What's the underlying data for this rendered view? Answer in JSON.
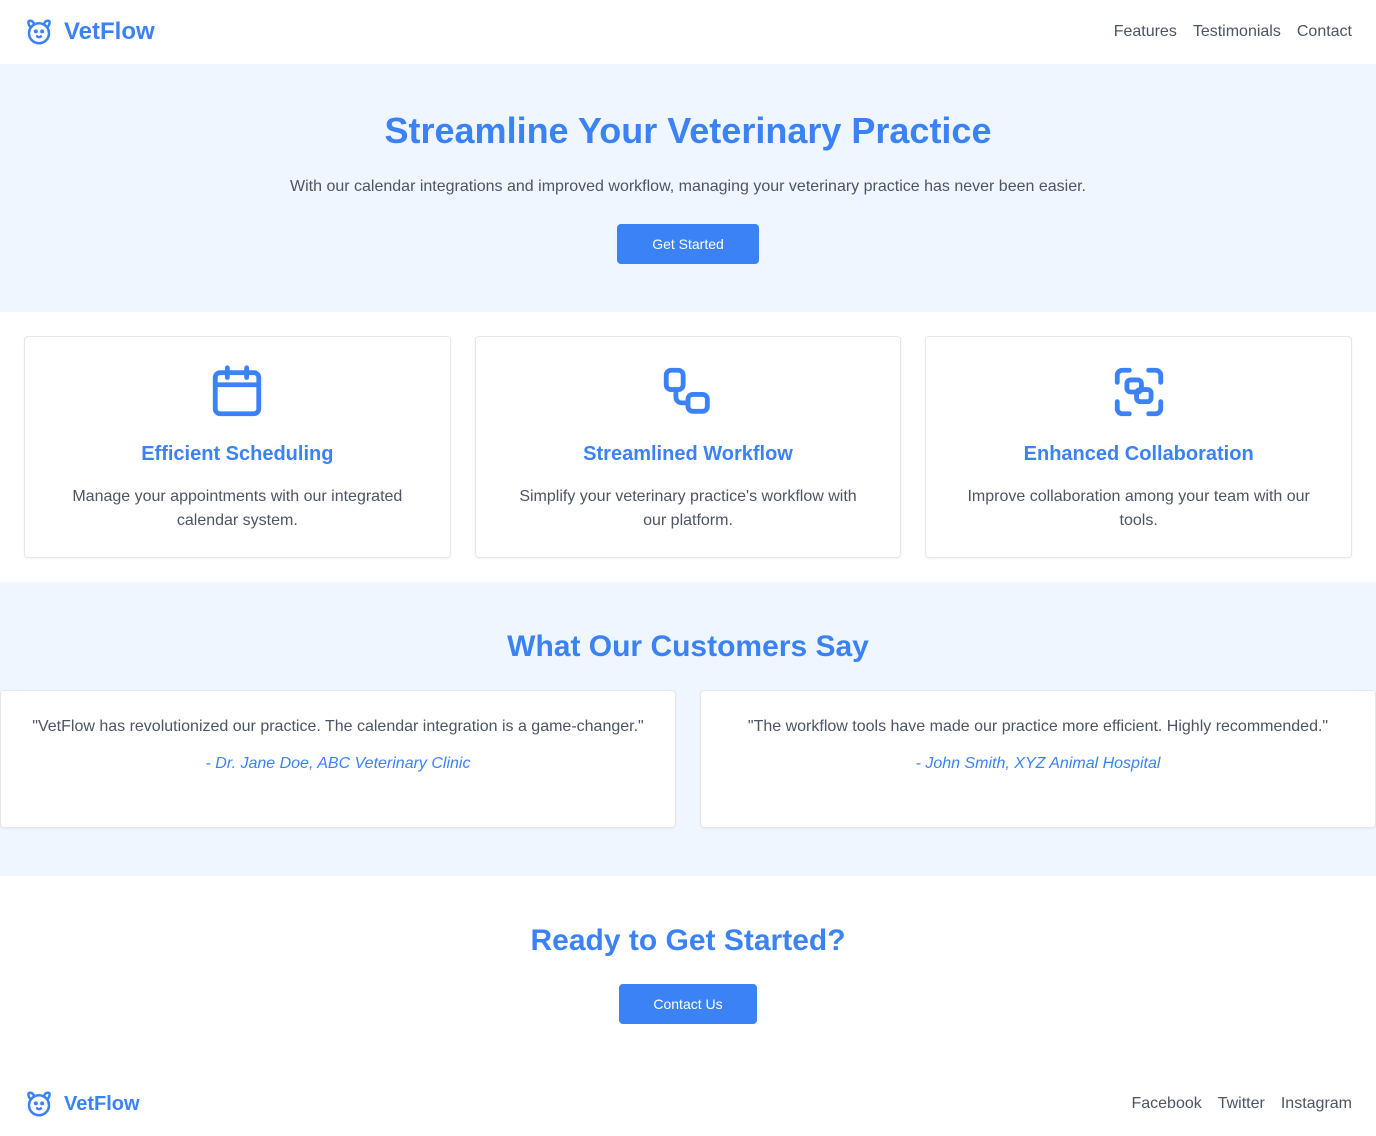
{
  "header": {
    "brand": "VetFlow",
    "brand_icon": "dog-icon",
    "nav": [
      "Features",
      "Testimonials",
      "Contact"
    ]
  },
  "hero": {
    "title": "Streamline Your Veterinary Practice",
    "subtitle": "With our calendar integrations and improved workflow, managing your veterinary practice has never been easier.",
    "cta_label": "Get Started"
  },
  "features": [
    {
      "icon": "calendar-icon",
      "title": "Efficient Scheduling",
      "description": "Manage your appointments with our integrated calendar system."
    },
    {
      "icon": "workflow-icon",
      "title": "Streamlined Workflow",
      "description": "Simplify your veterinary practice's workflow with our platform."
    },
    {
      "icon": "collaboration-icon",
      "title": "Enhanced Collaboration",
      "description": "Improve collaboration among your team with our tools."
    }
  ],
  "testimonials": {
    "title": "What Our Customers Say",
    "items": [
      {
        "quote": "\"VetFlow has revolutionized our practice. The calendar integration is a game-changer.\"",
        "author": "- Dr. Jane Doe, ABC Veterinary Clinic"
      },
      {
        "quote": "\"The workflow tools have made our practice more efficient. Highly recommended.\"",
        "author": "- John Smith, XYZ Animal Hospital"
      }
    ]
  },
  "cta": {
    "title": "Ready to Get Started?",
    "button_label": "Contact Us"
  },
  "footer": {
    "brand": "VetFlow",
    "links": [
      "Facebook",
      "Twitter",
      "Instagram"
    ]
  },
  "colors": {
    "accent": "#3b82f6",
    "section_bg": "#eff6ff",
    "text": "#4b5563"
  }
}
